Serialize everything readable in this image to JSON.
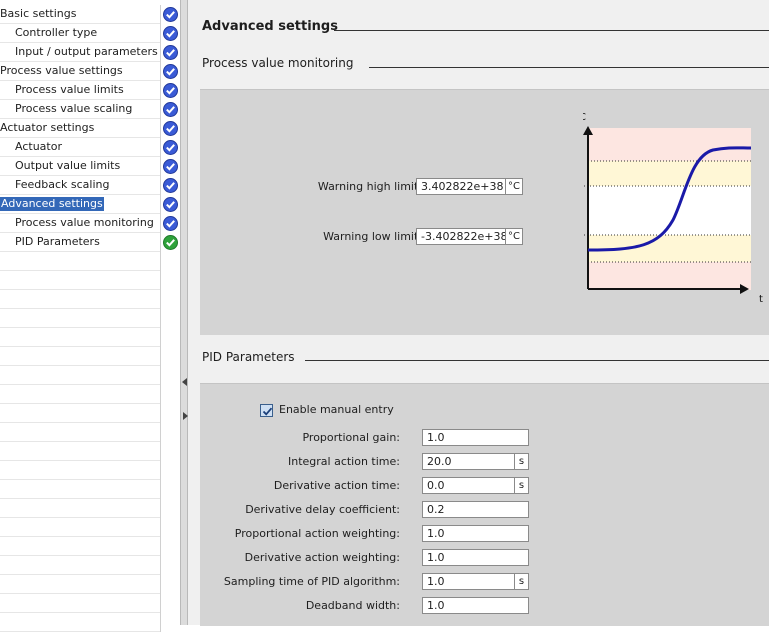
{
  "nav": {
    "items": [
      {
        "label": "Basic settings",
        "level": 0,
        "status": "check-blue"
      },
      {
        "label": "Controller type",
        "level": 1,
        "status": "check-blue"
      },
      {
        "label": "Input / output parameters",
        "level": 1,
        "status": "check-blue"
      },
      {
        "label": "Process value settings",
        "level": 0,
        "status": "check-blue"
      },
      {
        "label": "Process value limits",
        "level": 1,
        "status": "check-blue"
      },
      {
        "label": "Process value scaling",
        "level": 1,
        "status": "check-blue"
      },
      {
        "label": "Actuator settings",
        "level": 0,
        "status": "check-blue"
      },
      {
        "label": "Actuator",
        "level": 1,
        "status": "check-blue"
      },
      {
        "label": "Output value limits",
        "level": 1,
        "status": "check-blue"
      },
      {
        "label": "Feedback scaling",
        "level": 1,
        "status": "check-blue"
      },
      {
        "label": "Advanced settings",
        "level": 0,
        "status": "check-blue",
        "selected": true
      },
      {
        "label": "Process value monitoring",
        "level": 1,
        "status": "check-blue"
      },
      {
        "label": "PID Parameters",
        "level": 1,
        "status": "check-green"
      }
    ]
  },
  "main": {
    "title": "Advanced settings",
    "pv_monitoring": {
      "title": "Process value monitoring",
      "warning_high": {
        "label": "Warning high limit:",
        "value": "3.402822e+38",
        "unit": "°C"
      },
      "warning_low": {
        "label": "Warning low limit:",
        "value": "-3.402822e+38",
        "unit": "°C"
      },
      "chart": {
        "y_axis_label": "°C",
        "x_axis_label": "t"
      }
    },
    "pid": {
      "title": "PID Parameters",
      "enable_manual_entry": {
        "label": "Enable manual entry",
        "checked": true
      },
      "fields": [
        {
          "label": "Proportional gain:",
          "value": "1.0",
          "unit": ""
        },
        {
          "label": "Integral action time:",
          "value": "20.0",
          "unit": "s"
        },
        {
          "label": "Derivative action time:",
          "value": "0.0",
          "unit": "s"
        },
        {
          "label": "Derivative delay coefficient:",
          "value": "0.2",
          "unit": ""
        },
        {
          "label": "Proportional action weighting:",
          "value": "1.0",
          "unit": ""
        },
        {
          "label": "Derivative action weighting:",
          "value": "1.0",
          "unit": ""
        },
        {
          "label": "Sampling time of PID algorithm:",
          "value": "1.0",
          "unit": "s"
        },
        {
          "label": "Deadband width:",
          "value": "1.0",
          "unit": ""
        }
      ]
    }
  },
  "colors": {
    "selection": "#3368b8",
    "check_blue": "#3a5bd6",
    "check_green": "#2fa23b",
    "curve": "#1a1aa8",
    "warn_zone": "#fff7d6",
    "alarm_zone": "#fde6e1"
  }
}
